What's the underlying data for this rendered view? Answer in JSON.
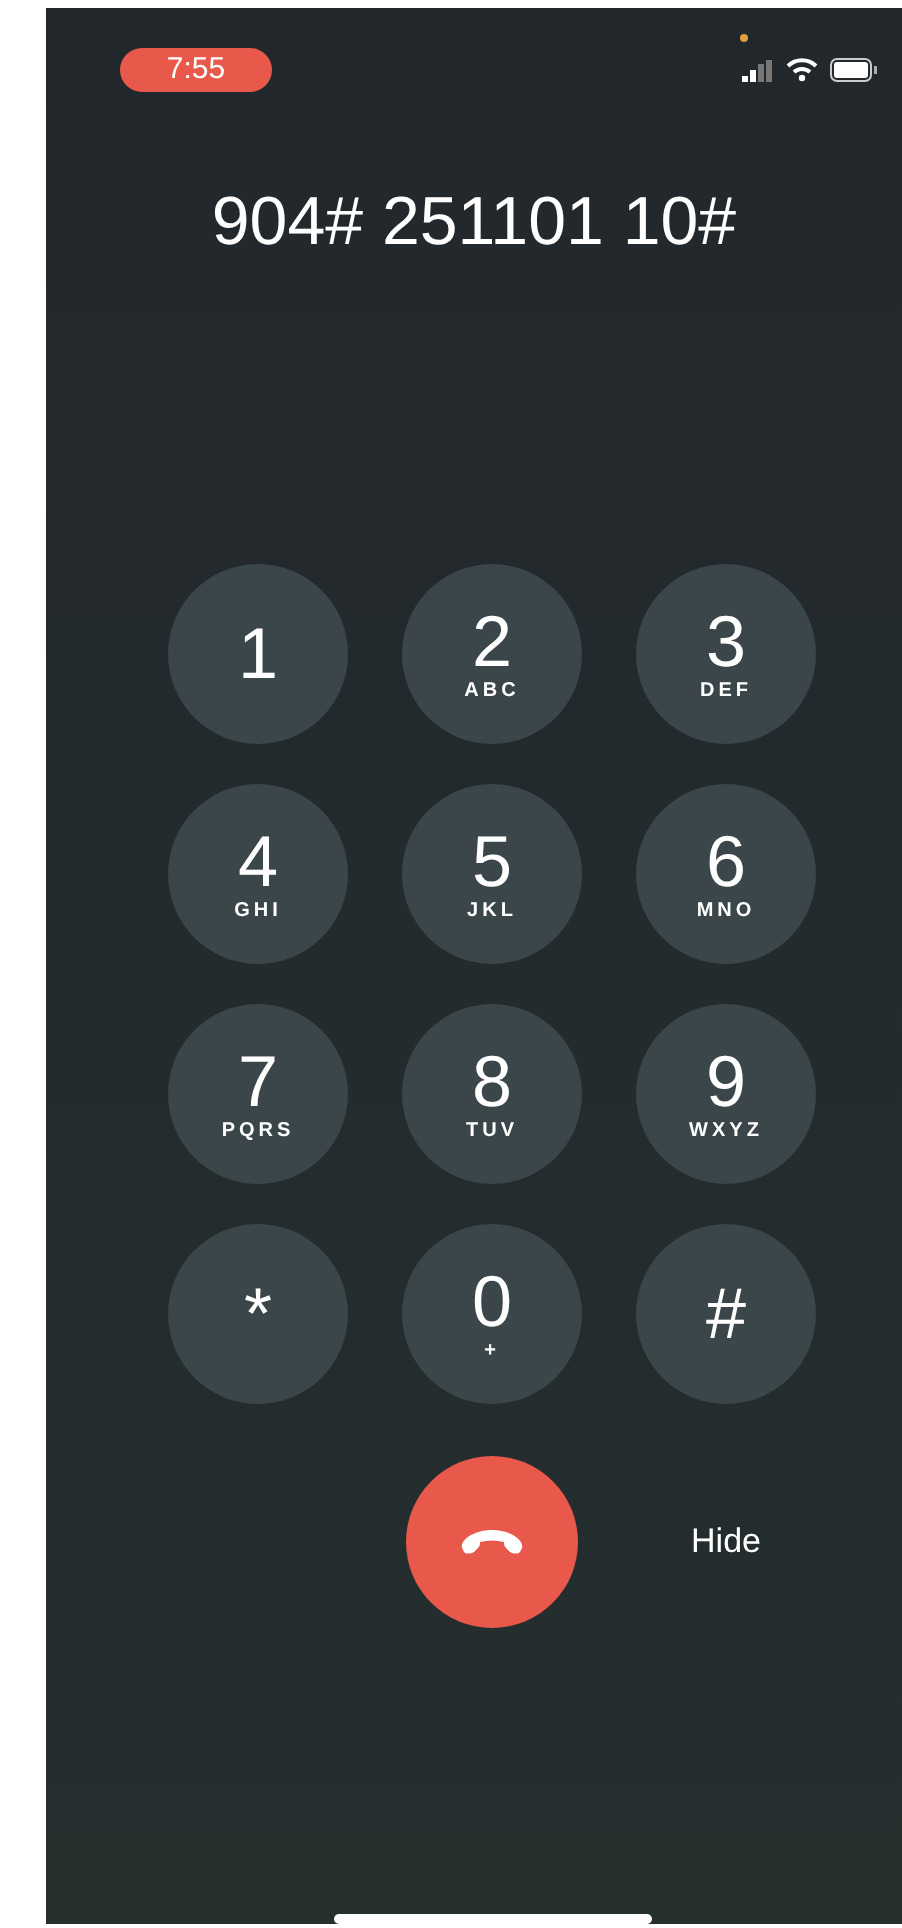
{
  "status_bar": {
    "time": "7:55"
  },
  "display": {
    "number": "904# 251101 10#"
  },
  "keys": [
    {
      "digit": "1"
    },
    {
      "digit": "2",
      "letters": "ABC"
    },
    {
      "digit": "3",
      "letters": "DEF"
    },
    {
      "digit": "4",
      "letters": "GHI"
    },
    {
      "digit": "5",
      "letters": "JKL"
    },
    {
      "digit": "6",
      "letters": "MNO"
    },
    {
      "digit": "7",
      "letters": "PQRS"
    },
    {
      "digit": "8",
      "letters": "TUV"
    },
    {
      "digit": "9",
      "letters": "WXYZ"
    },
    {
      "digit": "*"
    },
    {
      "digit": "0",
      "letters": "+"
    },
    {
      "digit": "#"
    }
  ],
  "hide_button": {
    "label": "Hide"
  }
}
